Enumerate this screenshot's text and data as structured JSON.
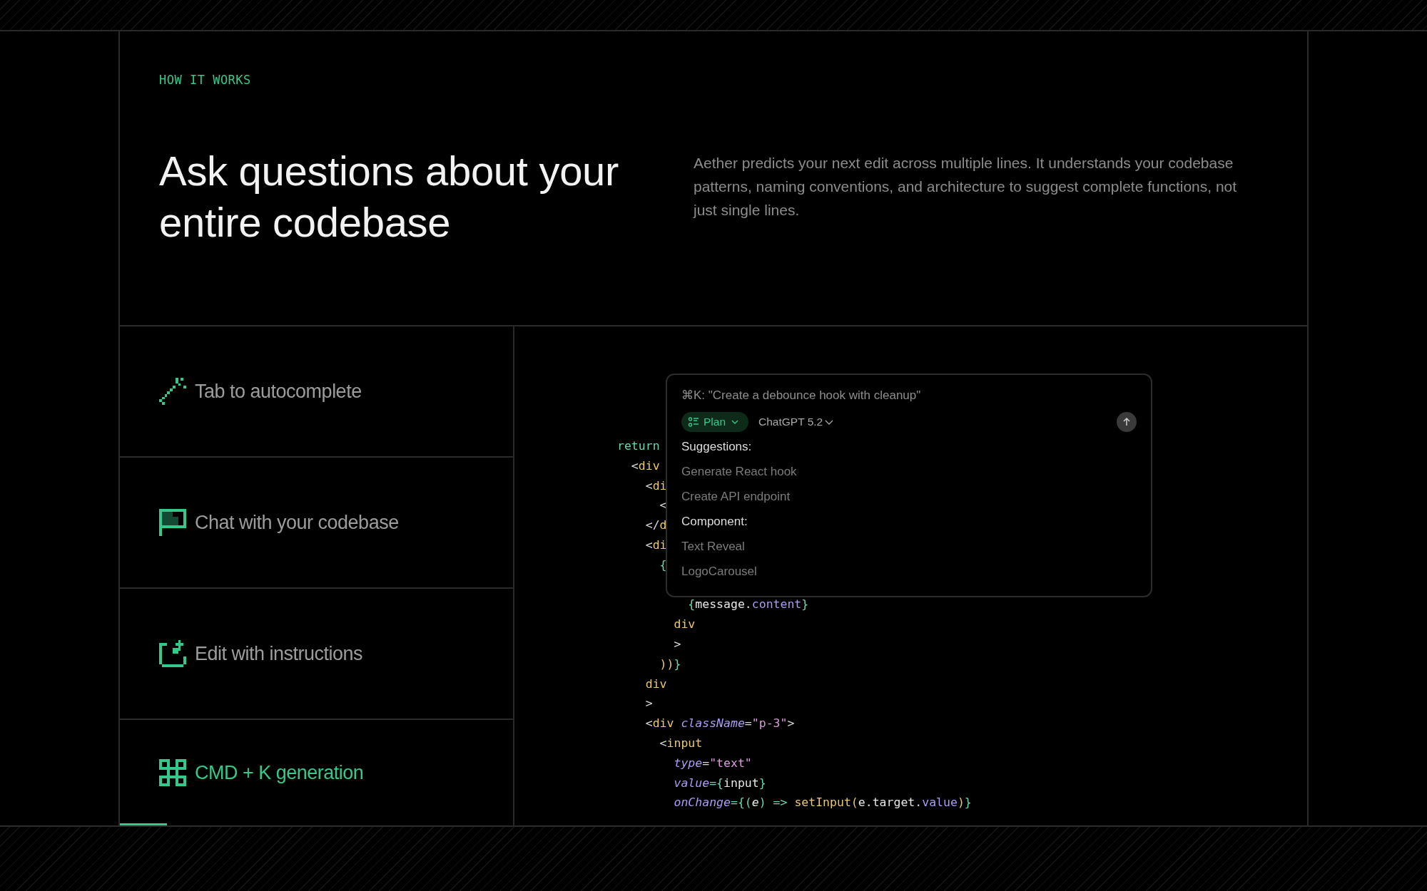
{
  "eyebrow": "HOW IT WORKS",
  "headline": "Ask questions about your entire codebase",
  "description": "Aether predicts your next edit across multiple lines. It understands your codebase patterns, naming conventions, and architecture to suggest complete functions, not just single lines.",
  "features": [
    {
      "kind": "wand",
      "label": "Tab to autocomplete",
      "selected": false
    },
    {
      "kind": "chat",
      "label": "Chat with your codebase",
      "selected": false
    },
    {
      "kind": "edit",
      "label": "Edit with instructions",
      "selected": false
    },
    {
      "kind": "command",
      "label": "CMD + K generation",
      "selected": true,
      "level": 0.12
    }
  ],
  "code_groups": [
    {
      "lines": [
        [
          {
            "text": "return",
            "kind": "kw"
          }
        ],
        [
          {
            "text": "  <",
            "kind": "punct"
          },
          {
            "text": "div",
            "kind": "tag"
          }
        ],
        [
          {
            "text": "    <",
            "kind": "punct"
          },
          {
            "text": "di",
            "kind": "tag"
          }
        ],
        [
          {
            "text": "      <",
            "kind": "punct"
          }
        ],
        [
          {
            "text": "    </",
            "kind": "punct"
          },
          {
            "text": "d",
            "kind": "tag"
          }
        ],
        [
          {
            "text": "    <",
            "kind": "punct"
          },
          {
            "text": "di",
            "kind": "tag"
          }
        ],
        [
          {
            "text": "      {",
            "kind": "brace"
          }
        ]
      ]
    },
    {
      "lines": [
        [
          {
            "text": "          {",
            "kind": "brace"
          },
          {
            "text": "message",
            "kind": "ident"
          },
          {
            "text": ".",
            "kind": "punct"
          },
          {
            "text": "content",
            "kind": "prop"
          },
          {
            "text": "}",
            "kind": "brace"
          }
        ],
        [
          {
            "text": "        div",
            "kind": "tag"
          }
        ],
        [
          {
            "text": "        >",
            "kind": "punct"
          }
        ],
        [
          {
            "text": "      ))",
            "kind": "tag"
          },
          {
            "text": "}",
            "kind": "brace"
          }
        ],
        [
          {
            "text": "    div",
            "kind": "tag"
          }
        ],
        [
          {
            "text": "    >",
            "kind": "punct"
          }
        ],
        [
          {
            "text": "    <",
            "kind": "punct"
          },
          {
            "text": "div",
            "kind": "tag"
          },
          {
            "text": " className",
            "kind": "attr"
          },
          {
            "text": "=",
            "kind": "punct"
          },
          {
            "text": "\"p-3\"",
            "kind": "str"
          },
          {
            "text": ">",
            "kind": "punct"
          }
        ],
        [
          {
            "text": "      <",
            "kind": "punct"
          },
          {
            "text": "input",
            "kind": "tag"
          }
        ],
        [
          {
            "text": "        type",
            "kind": "attr"
          },
          {
            "text": "=",
            "kind": "punct"
          },
          {
            "text": "\"text\"",
            "kind": "str"
          }
        ],
        [
          {
            "text": "        value",
            "kind": "attr"
          },
          {
            "text": "={",
            "kind": "brace"
          },
          {
            "text": "input",
            "kind": "ident"
          },
          {
            "text": "}",
            "kind": "brace"
          }
        ],
        [
          {
            "text": "        onChange",
            "kind": "attr"
          },
          {
            "text": "={(",
            "kind": "brace"
          },
          {
            "text": "e",
            "kind": "param"
          },
          {
            "text": ") ",
            "kind": "brace"
          },
          {
            "text": "=>",
            "kind": "kw"
          },
          {
            "text": " setInput",
            "kind": "fn"
          },
          {
            "text": "(",
            "kind": "tag"
          },
          {
            "text": "e",
            "kind": "ident"
          },
          {
            "text": ".",
            "kind": "punct"
          },
          {
            "text": "target",
            "kind": "ident"
          },
          {
            "text": ".",
            "kind": "punct"
          },
          {
            "text": "value",
            "kind": "prop"
          },
          {
            "text": ")",
            "kind": "tag"
          },
          {
            "text": "}",
            "kind": "brace"
          }
        ]
      ]
    }
  ],
  "command_dialog": {
    "prompt": "⌘K: \"Create a debounce hook with cleanup\"",
    "mode": {
      "label": "Plan"
    },
    "model": {
      "label": "ChatGPT 5.2"
    },
    "sections": [
      {
        "heading": "Suggestions:",
        "items": [
          "Generate React hook",
          "Create API endpoint"
        ]
      },
      {
        "heading": "Component:",
        "items": [
          "Text Reveal",
          "LogoCarousel"
        ]
      }
    ]
  }
}
